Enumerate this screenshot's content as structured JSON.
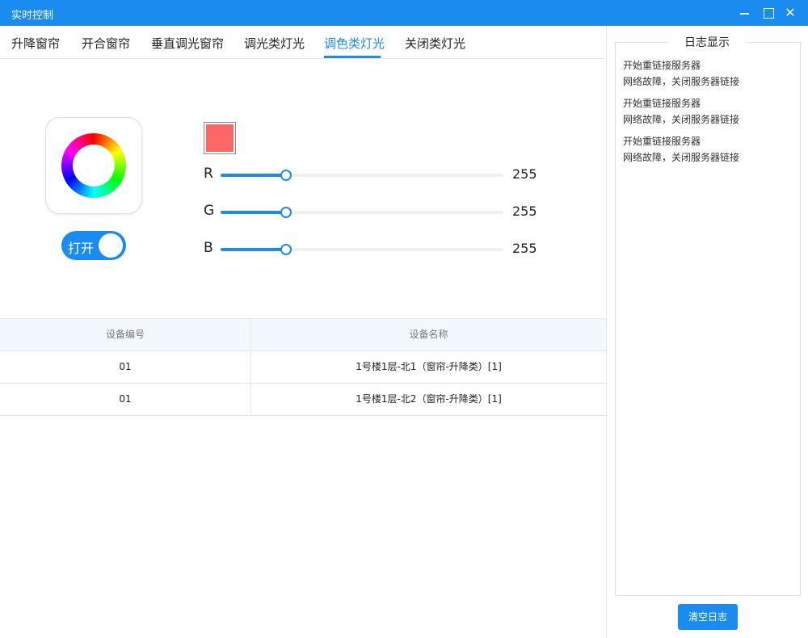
{
  "window": {
    "title": "实时控制",
    "minimize_icon": "minimize-icon",
    "maximize_icon": "maximize-icon",
    "close_icon": "close-icon",
    "close_glyph": "✕"
  },
  "tabs": [
    {
      "label": "升降窗帘"
    },
    {
      "label": "开合窗帘"
    },
    {
      "label": "垂直调光窗帘"
    },
    {
      "label": "调光类灯光"
    },
    {
      "label": "调色类灯光",
      "active": true
    },
    {
      "label": "关闭类灯光"
    }
  ],
  "color_control": {
    "wheel_icon": "color-wheel-icon",
    "toggle_label": "打开",
    "toggle_on": true,
    "swatch_color": "#ff6666",
    "accent_color": "#1a8cf0",
    "sliders": [
      {
        "letter": "R",
        "value": "255",
        "fraction": 0.23
      },
      {
        "letter": "G",
        "value": "255",
        "fraction": 0.23
      },
      {
        "letter": "B",
        "value": "255",
        "fraction": 0.23
      }
    ]
  },
  "device_table": {
    "headers": [
      "设备编号",
      "设备名称"
    ],
    "rows": [
      [
        "01",
        "1号楼1层-北1（窗帘-升降类）[1]"
      ],
      [
        "01",
        "1号楼1层-北2（窗帘-升降类）[1]"
      ]
    ]
  },
  "log_panel": {
    "title": "日志显示",
    "entries": [
      [
        "开始重链接服务器",
        "网络故障，关闭服务器链接"
      ],
      [
        "开始重链接服务器",
        "网络故障，关闭服务器链接"
      ],
      [
        "开始重链接服务器",
        "网络故障，关闭服务器链接"
      ]
    ],
    "clear_button": "清空日志"
  }
}
